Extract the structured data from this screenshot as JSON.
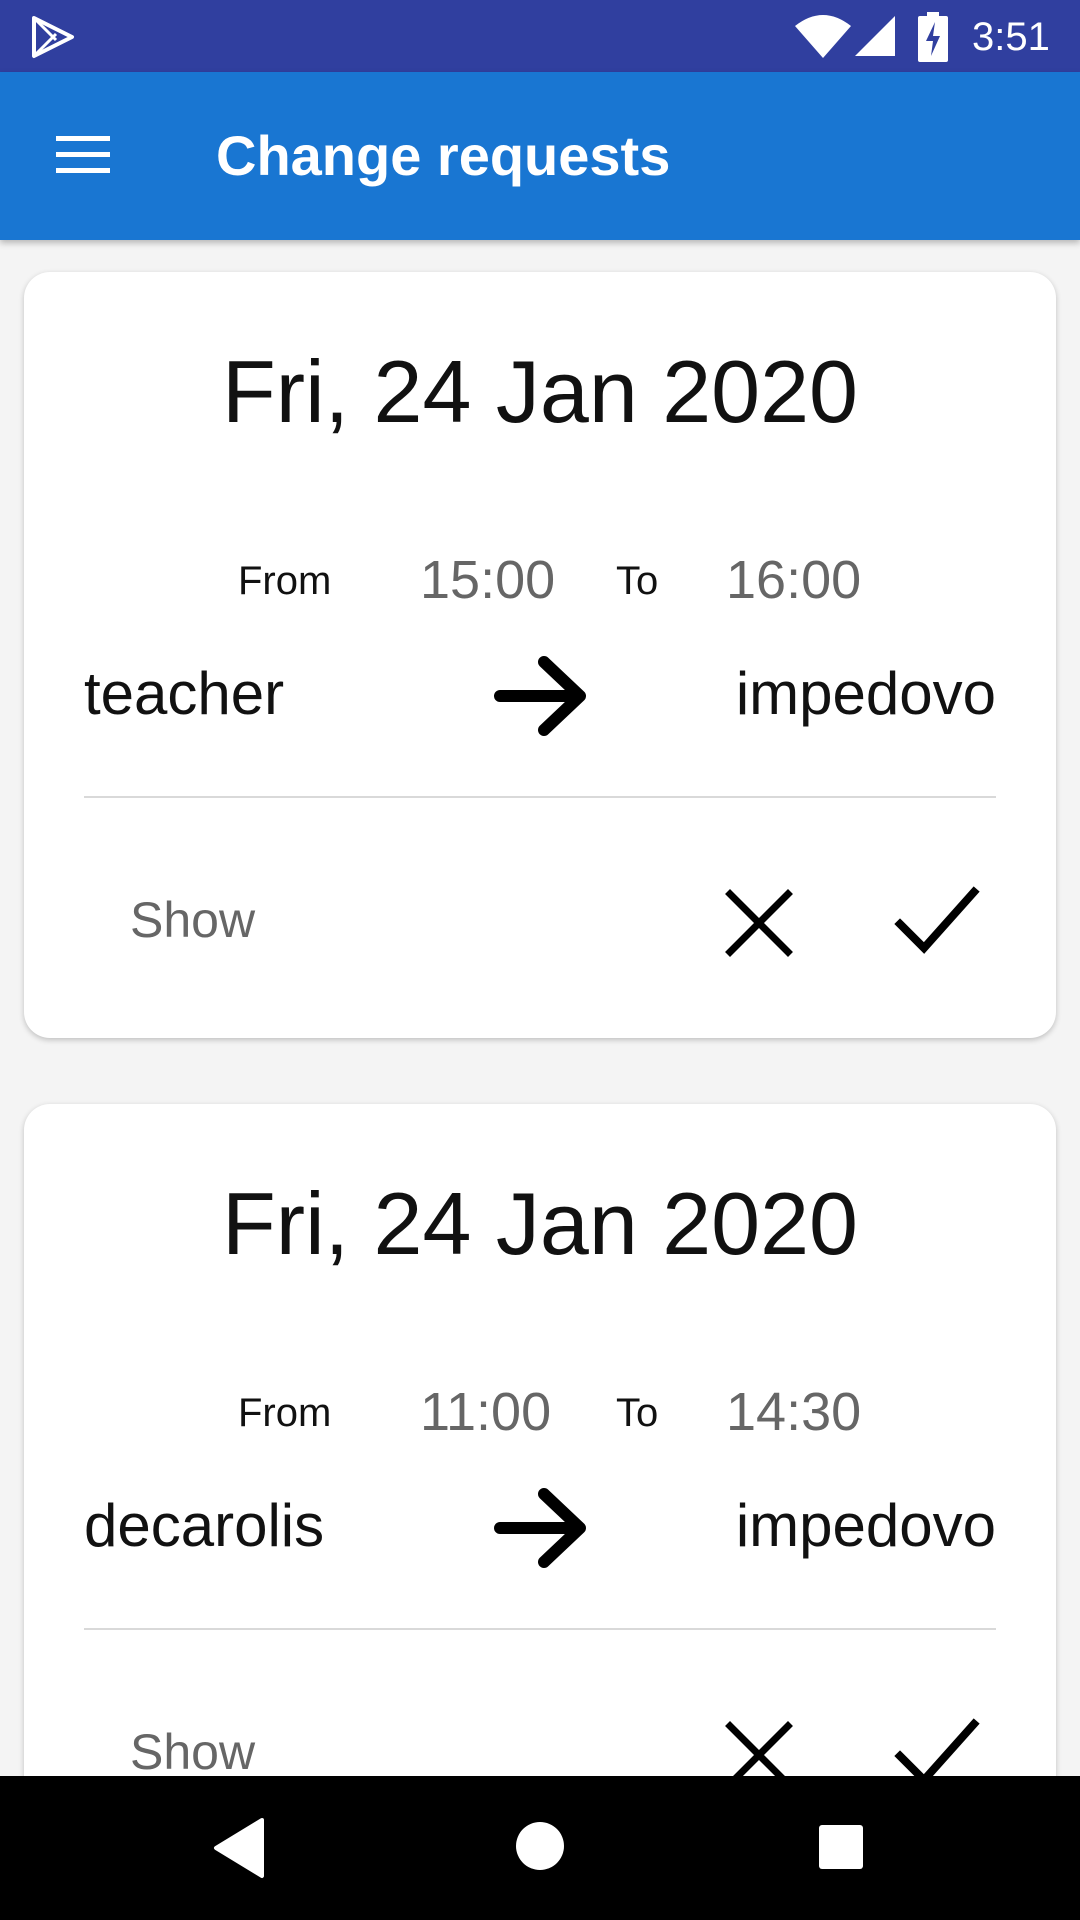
{
  "status_bar": {
    "time": "3:51",
    "icons": [
      "play-store-icon",
      "wifi-icon",
      "signal-icon",
      "battery-charging-icon"
    ]
  },
  "app_bar": {
    "title": "Change requests",
    "menu_icon": "hamburger-menu-icon"
  },
  "requests": [
    {
      "date": "Fri, 24 Jan 2020",
      "from_label": "From",
      "from_time": "15:00",
      "to_label": "To",
      "to_time": "16:00",
      "requester": "teacher",
      "target": "impedovo",
      "show_label": "Show"
    },
    {
      "date": "Fri, 24 Jan 2020",
      "from_label": "From",
      "from_time": "11:00",
      "to_label": "To",
      "to_time": "14:30",
      "requester": "decarolis",
      "target": "impedovo",
      "show_label": "Show"
    }
  ],
  "nav_bar": {
    "icons": [
      "back-icon",
      "home-icon",
      "recents-icon"
    ]
  },
  "colors": {
    "status_bar": "#303f9f",
    "app_bar": "#1976d2",
    "background": "#f4f4f4",
    "card": "#ffffff",
    "muted_text": "#666666"
  }
}
